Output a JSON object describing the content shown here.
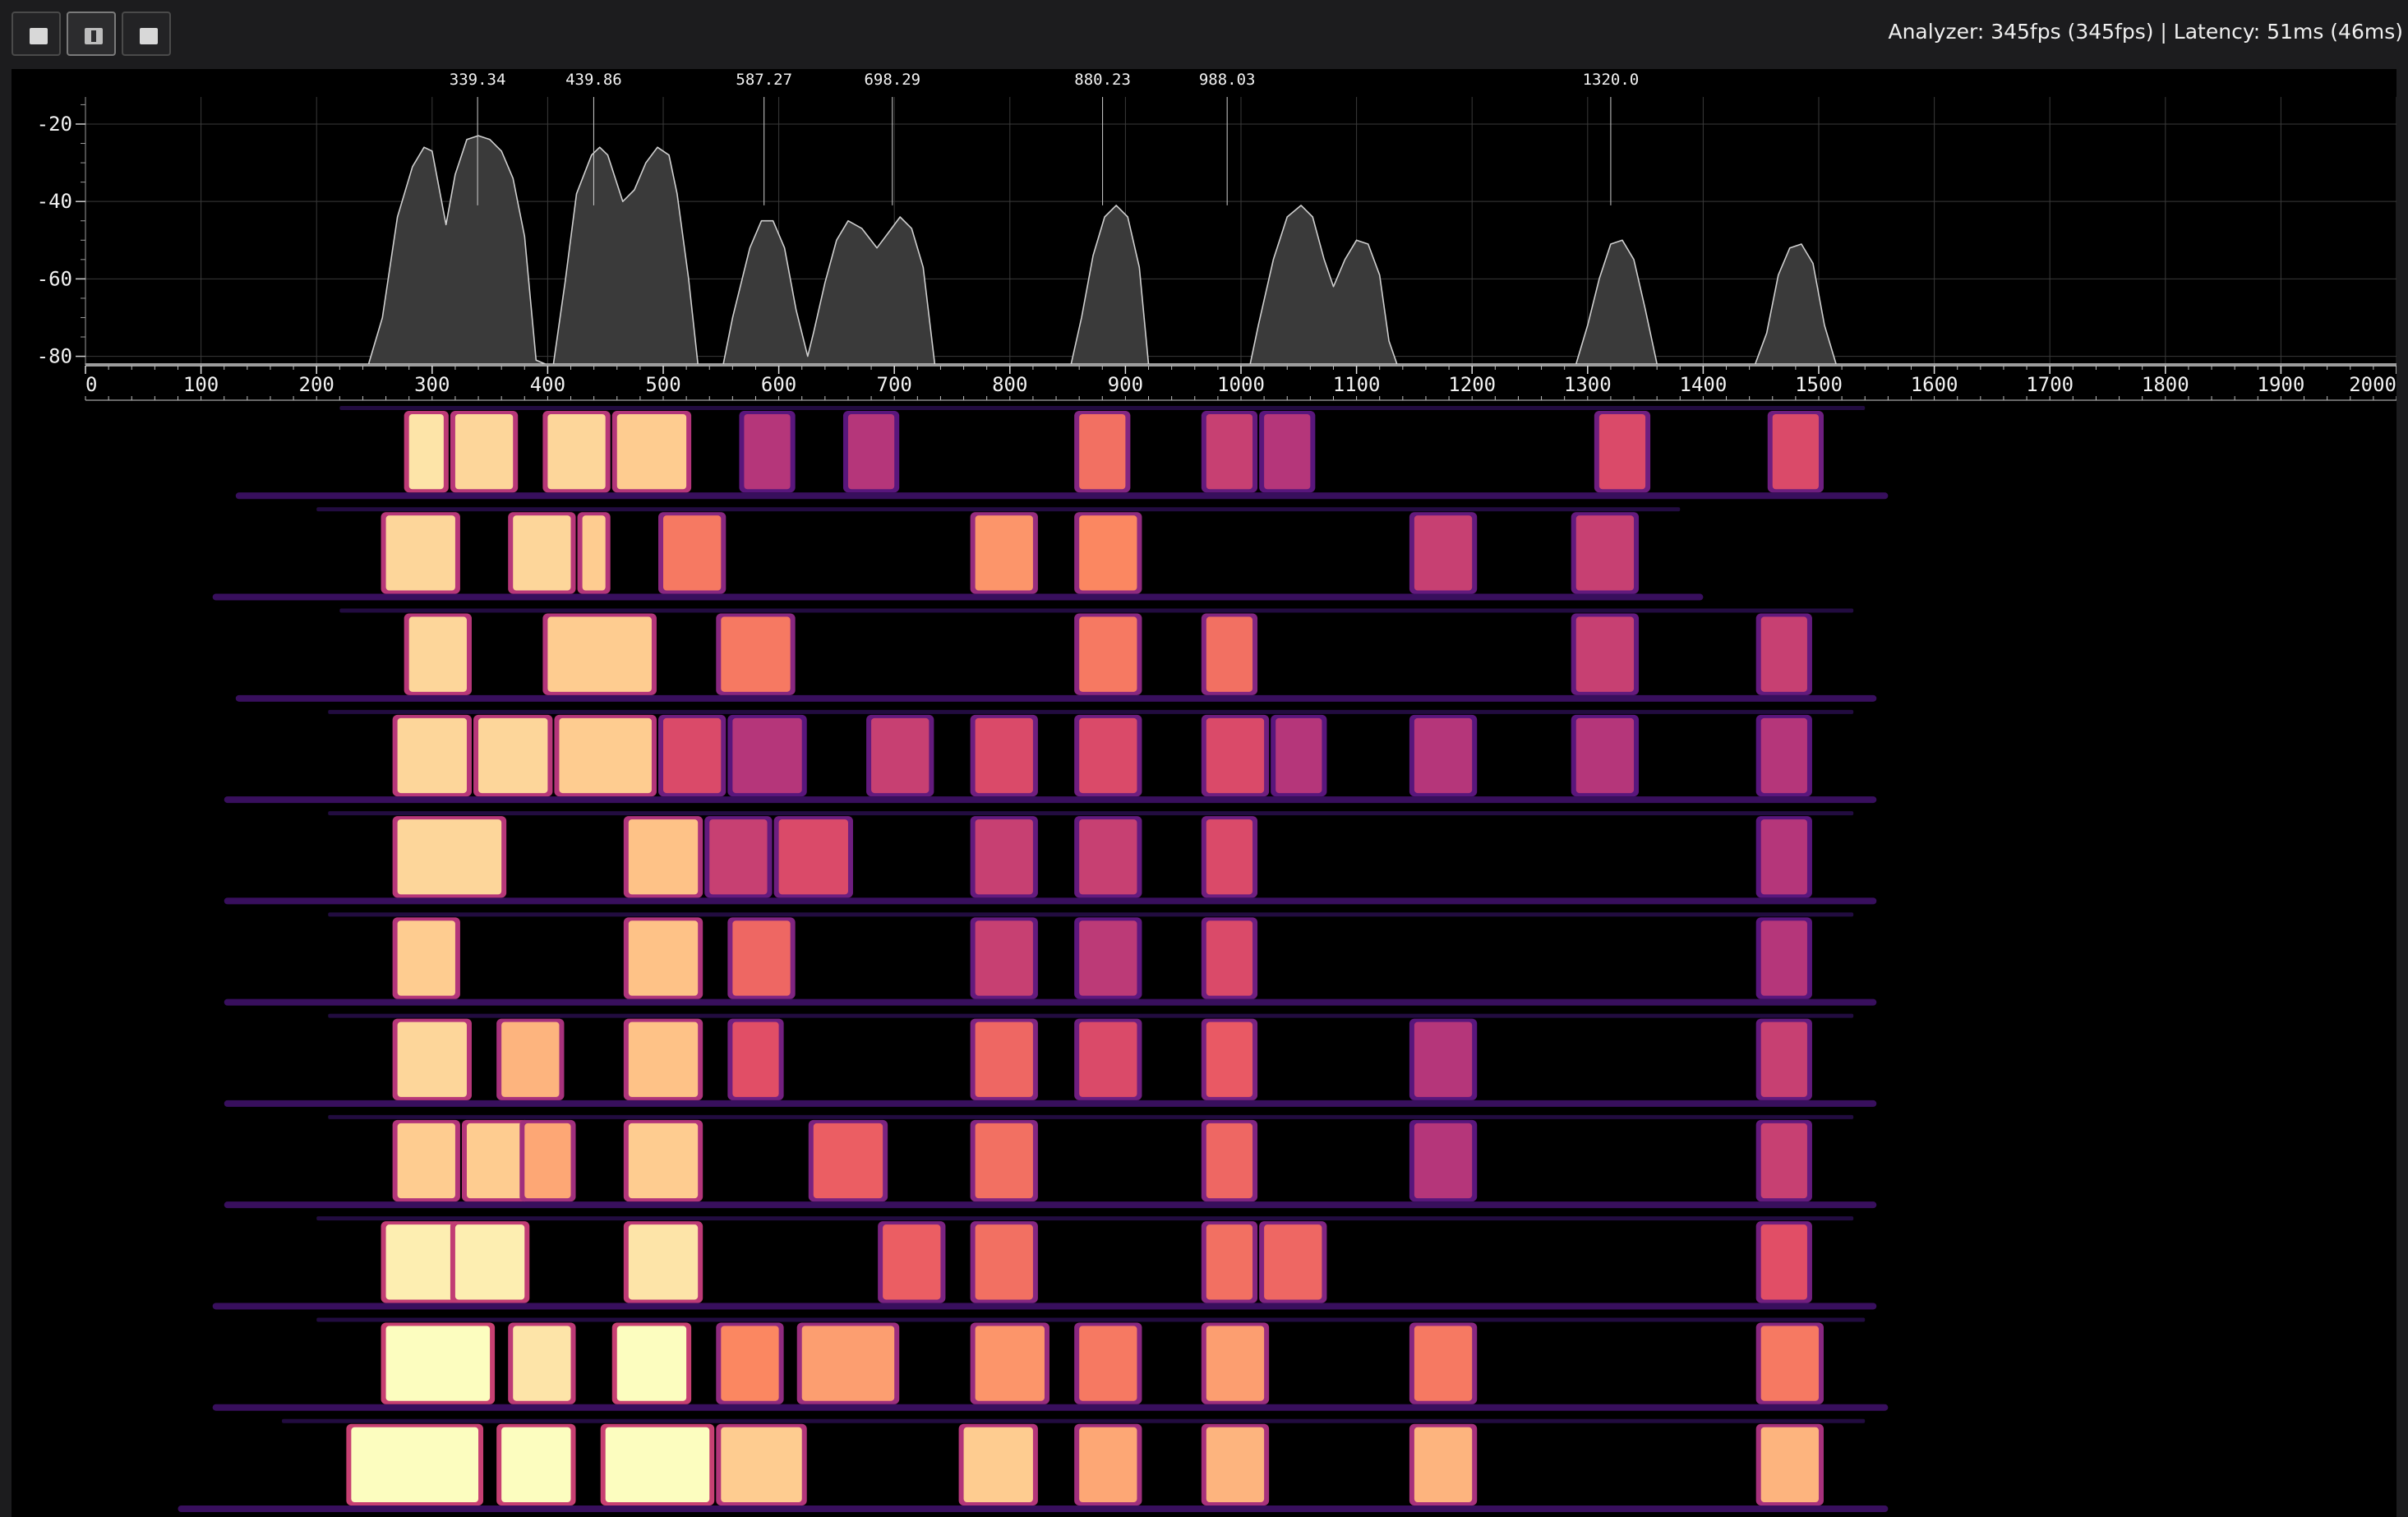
{
  "toolbar": {
    "buttons": [
      {
        "name": "layout-button-1",
        "active": false
      },
      {
        "name": "layout-button-2",
        "active": true
      },
      {
        "name": "layout-button-3",
        "active": false
      }
    ],
    "status_text": "Analyzer: 345fps (345fps) | Latency: 51ms (46ms)"
  },
  "chart_data": {
    "type": "area",
    "title": "",
    "xlabel": "",
    "ylabel": "",
    "xlim": [
      0,
      2000
    ],
    "ylim": [
      -82,
      -13
    ],
    "grid": true,
    "x_ticks": [
      0,
      100,
      200,
      300,
      400,
      500,
      600,
      700,
      800,
      900,
      1000,
      1100,
      1200,
      1300,
      1400,
      1500,
      1600,
      1700,
      1800,
      1900,
      2000
    ],
    "y_ticks": [
      -20,
      -40,
      -60,
      -80
    ],
    "series": [
      {
        "points": [
          [
            0,
            -82
          ],
          [
            245,
            -82
          ],
          [
            257,
            -70
          ],
          [
            270,
            -44
          ],
          [
            283,
            -31
          ],
          [
            293,
            -26
          ],
          [
            300,
            -27
          ],
          [
            312,
            -46
          ],
          [
            320,
            -33
          ],
          [
            330,
            -24
          ],
          [
            340,
            -23
          ],
          [
            350,
            -24
          ],
          [
            360,
            -27
          ],
          [
            370,
            -34
          ],
          [
            380,
            -49
          ],
          [
            390,
            -81
          ],
          [
            398,
            -82
          ],
          [
            405,
            -82
          ],
          [
            415,
            -61
          ],
          [
            425,
            -38
          ],
          [
            438,
            -28
          ],
          [
            445,
            -26
          ],
          [
            452,
            -28
          ],
          [
            465,
            -40
          ],
          [
            475,
            -37
          ],
          [
            485,
            -30
          ],
          [
            495,
            -26
          ],
          [
            505,
            -28
          ],
          [
            512,
            -38
          ],
          [
            522,
            -60
          ],
          [
            530,
            -82
          ],
          [
            552,
            -82
          ],
          [
            560,
            -70
          ],
          [
            575,
            -52
          ],
          [
            585,
            -45
          ],
          [
            595,
            -45
          ],
          [
            605,
            -52
          ],
          [
            615,
            -68
          ],
          [
            625,
            -80
          ],
          [
            630,
            -74
          ],
          [
            640,
            -61
          ],
          [
            650,
            -50
          ],
          [
            660,
            -45
          ],
          [
            672,
            -47
          ],
          [
            685,
            -52
          ],
          [
            695,
            -48
          ],
          [
            705,
            -44
          ],
          [
            715,
            -47
          ],
          [
            725,
            -57
          ],
          [
            735,
            -82
          ],
          [
            853,
            -82
          ],
          [
            862,
            -70
          ],
          [
            872,
            -54
          ],
          [
            882,
            -44
          ],
          [
            892,
            -41
          ],
          [
            902,
            -44
          ],
          [
            912,
            -57
          ],
          [
            920,
            -82
          ],
          [
            1008,
            -82
          ],
          [
            1015,
            -72
          ],
          [
            1028,
            -55
          ],
          [
            1040,
            -44
          ],
          [
            1052,
            -41
          ],
          [
            1062,
            -44
          ],
          [
            1072,
            -55
          ],
          [
            1080,
            -62
          ],
          [
            1090,
            -55
          ],
          [
            1100,
            -50
          ],
          [
            1110,
            -51
          ],
          [
            1120,
            -59
          ],
          [
            1128,
            -76
          ],
          [
            1135,
            -82
          ],
          [
            1290,
            -82
          ],
          [
            1300,
            -72
          ],
          [
            1310,
            -60
          ],
          [
            1320,
            -51
          ],
          [
            1330,
            -50
          ],
          [
            1340,
            -55
          ],
          [
            1350,
            -68
          ],
          [
            1360,
            -82
          ],
          [
            1445,
            -82
          ],
          [
            1455,
            -74
          ],
          [
            1465,
            -59
          ],
          [
            1475,
            -52
          ],
          [
            1485,
            -51
          ],
          [
            1495,
            -56
          ],
          [
            1505,
            -72
          ],
          [
            1515,
            -82
          ],
          [
            2000,
            -82
          ]
        ]
      }
    ],
    "peak_annotations": [
      {
        "x": 339.34,
        "label": "339.34"
      },
      {
        "x": 439.86,
        "label": "439.86"
      },
      {
        "x": 587.27,
        "label": "587.27"
      },
      {
        "x": 698.29,
        "label": "698.29"
      },
      {
        "x": 880.23,
        "label": "880.23"
      },
      {
        "x": 988.03,
        "label": "988.03"
      },
      {
        "x": 1320.0,
        "label": "1320.0"
      }
    ],
    "colors": {
      "fill": "#3a3a3a",
      "line": "#d0d0d0",
      "grid": "#3a3a3a",
      "axis_text": "#f2f2f2"
    }
  },
  "spectrogram": {
    "colormap": "magma",
    "rows": [
      {
        "blocks": [
          [
            280,
            310,
            0.95
          ],
          [
            320,
            370,
            0.92
          ],
          [
            400,
            450,
            0.92
          ],
          [
            460,
            520,
            0.9
          ],
          [
            570,
            610,
            0.5
          ],
          [
            660,
            700,
            0.5
          ],
          [
            860,
            900,
            0.7
          ],
          [
            970,
            1010,
            0.55
          ],
          [
            1020,
            1060,
            0.5
          ],
          [
            1310,
            1350,
            0.6
          ],
          [
            1460,
            1500,
            0.6
          ]
        ]
      },
      {
        "blocks": [
          [
            260,
            320,
            0.92
          ],
          [
            370,
            420,
            0.92
          ],
          [
            430,
            450,
            0.9
          ],
          [
            500,
            550,
            0.72
          ],
          [
            770,
            820,
            0.78
          ],
          [
            860,
            910,
            0.75
          ],
          [
            1150,
            1200,
            0.55
          ],
          [
            1290,
            1340,
            0.55
          ]
        ]
      },
      {
        "blocks": [
          [
            280,
            330,
            0.92
          ],
          [
            400,
            490,
            0.9
          ],
          [
            550,
            610,
            0.72
          ],
          [
            860,
            910,
            0.72
          ],
          [
            970,
            1010,
            0.7
          ],
          [
            1290,
            1340,
            0.55
          ],
          [
            1450,
            1490,
            0.55
          ]
        ]
      },
      {
        "blocks": [
          [
            270,
            330,
            0.92
          ],
          [
            340,
            400,
            0.92
          ],
          [
            410,
            490,
            0.9
          ],
          [
            500,
            550,
            0.6
          ],
          [
            560,
            620,
            0.5
          ],
          [
            680,
            730,
            0.55
          ],
          [
            770,
            820,
            0.6
          ],
          [
            860,
            910,
            0.6
          ],
          [
            970,
            1020,
            0.6
          ],
          [
            1030,
            1070,
            0.5
          ],
          [
            1150,
            1200,
            0.5
          ],
          [
            1290,
            1340,
            0.5
          ],
          [
            1450,
            1490,
            0.5
          ]
        ]
      },
      {
        "blocks": [
          [
            270,
            360,
            0.92
          ],
          [
            470,
            530,
            0.88
          ],
          [
            540,
            590,
            0.55
          ],
          [
            600,
            660,
            0.6
          ],
          [
            770,
            820,
            0.55
          ],
          [
            860,
            910,
            0.55
          ],
          [
            970,
            1010,
            0.6
          ],
          [
            1450,
            1490,
            0.5
          ]
        ]
      },
      {
        "blocks": [
          [
            270,
            320,
            0.9
          ],
          [
            470,
            530,
            0.88
          ],
          [
            560,
            610,
            0.68
          ],
          [
            770,
            820,
            0.55
          ],
          [
            860,
            910,
            0.52
          ],
          [
            970,
            1010,
            0.6
          ],
          [
            1450,
            1490,
            0.5
          ]
        ]
      },
      {
        "blocks": [
          [
            270,
            330,
            0.92
          ],
          [
            360,
            410,
            0.85
          ],
          [
            470,
            530,
            0.88
          ],
          [
            560,
            600,
            0.62
          ],
          [
            770,
            820,
            0.68
          ],
          [
            860,
            910,
            0.6
          ],
          [
            970,
            1010,
            0.65
          ],
          [
            1150,
            1200,
            0.5
          ],
          [
            1450,
            1490,
            0.55
          ]
        ]
      },
      {
        "blocks": [
          [
            270,
            320,
            0.9
          ],
          [
            330,
            380,
            0.9
          ],
          [
            380,
            420,
            0.82
          ],
          [
            470,
            530,
            0.9
          ],
          [
            630,
            690,
            0.66
          ],
          [
            770,
            820,
            0.7
          ],
          [
            970,
            1010,
            0.68
          ],
          [
            1150,
            1200,
            0.5
          ],
          [
            1450,
            1490,
            0.55
          ]
        ]
      },
      {
        "blocks": [
          [
            260,
            320,
            0.97
          ],
          [
            320,
            380,
            0.97
          ],
          [
            470,
            530,
            0.95
          ],
          [
            690,
            740,
            0.66
          ],
          [
            770,
            820,
            0.7
          ],
          [
            970,
            1010,
            0.7
          ],
          [
            1020,
            1070,
            0.68
          ],
          [
            1450,
            1490,
            0.62
          ]
        ]
      },
      {
        "blocks": [
          [
            260,
            350,
            1.0
          ],
          [
            370,
            420,
            0.95
          ],
          [
            460,
            520,
            1.0
          ],
          [
            550,
            600,
            0.75
          ],
          [
            620,
            700,
            0.8
          ],
          [
            770,
            830,
            0.78
          ],
          [
            860,
            910,
            0.72
          ],
          [
            970,
            1020,
            0.8
          ],
          [
            1150,
            1200,
            0.72
          ],
          [
            1450,
            1500,
            0.72
          ]
        ]
      },
      {
        "blocks": [
          [
            230,
            340,
            1.0
          ],
          [
            360,
            420,
            1.0
          ],
          [
            450,
            540,
            1.0
          ],
          [
            550,
            620,
            0.9
          ],
          [
            760,
            820,
            0.9
          ],
          [
            860,
            910,
            0.82
          ],
          [
            970,
            1020,
            0.85
          ],
          [
            1150,
            1200,
            0.85
          ],
          [
            1450,
            1500,
            0.85
          ]
        ]
      }
    ]
  }
}
